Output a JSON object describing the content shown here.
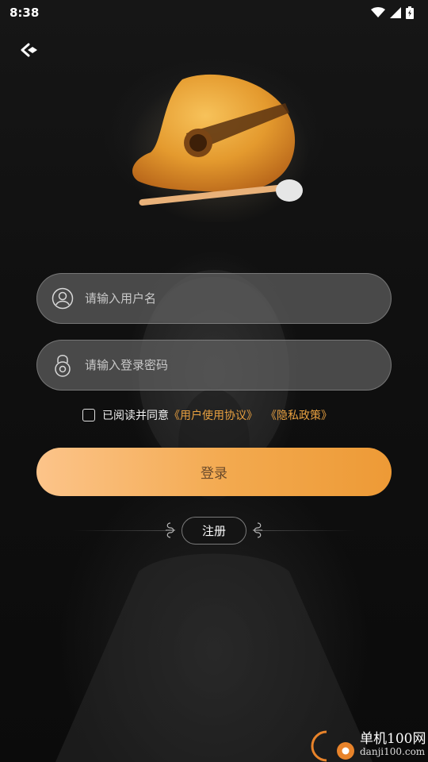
{
  "status_bar": {
    "time": "8:38"
  },
  "login": {
    "username_placeholder": "请输入用户名",
    "password_placeholder": "请输入登录密码",
    "agreement_prefix": "已阅读并同意",
    "user_agreement": "《用户使用协议》",
    "privacy_policy": "《隐私政策》",
    "login_button": "登录",
    "register_button": "注册"
  },
  "watermark": {
    "name": "单机100网",
    "url": "danji100.com"
  },
  "colors": {
    "accent": "#f3a94e",
    "link": "#e8a040",
    "background": "#0d0d0d"
  }
}
